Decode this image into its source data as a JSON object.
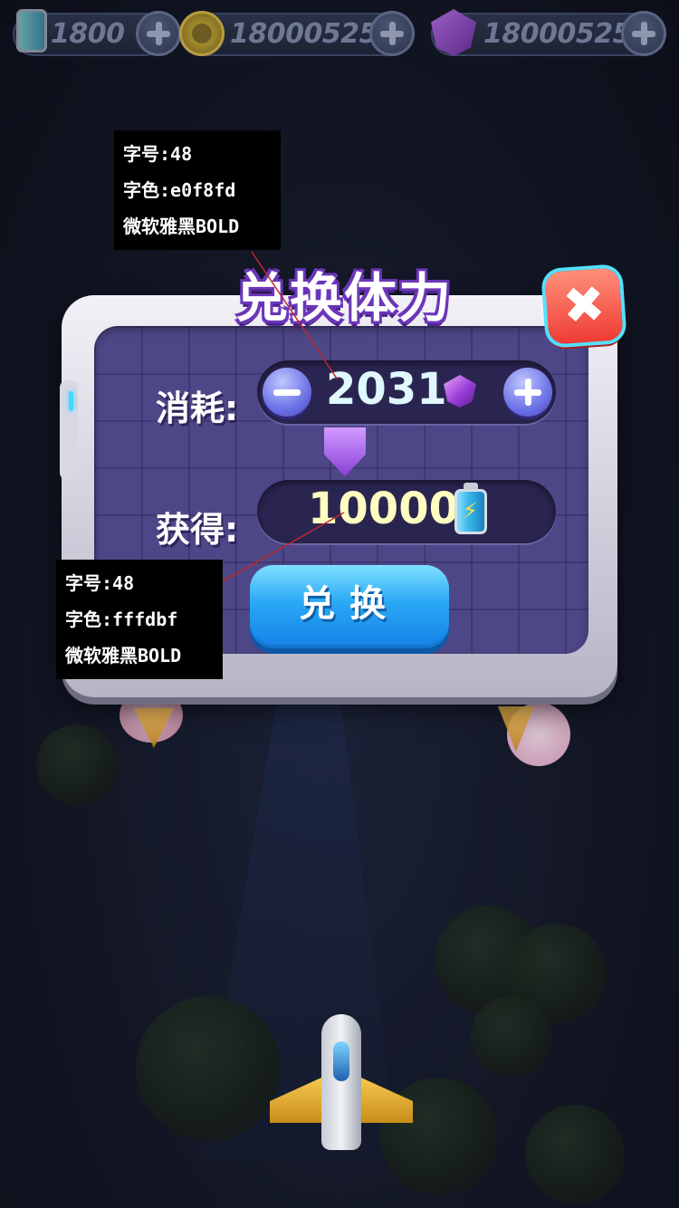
{
  "resources": {
    "energy": {
      "icon": "battery-icon",
      "value": "1800"
    },
    "coins": {
      "icon": "coin-icon",
      "value": "18000525"
    },
    "gems": {
      "icon": "gem-icon",
      "value": "18000525"
    }
  },
  "dialog": {
    "title": "兑换体力",
    "close_icon": "close-icon",
    "cost": {
      "label": "消耗:",
      "value": "2031",
      "icon": "gem-icon"
    },
    "gain": {
      "label": "获得:",
      "value": "10000",
      "icon": "battery-icon"
    },
    "exchange_button": "兑换"
  },
  "annotations": {
    "title_spec": {
      "size": "字号:48",
      "color": "字色:e0f8fd",
      "font": "微软雅黑BOLD"
    },
    "number_spec": {
      "size": "字号:48",
      "color": "字色:fffdbf",
      "font": "微软雅黑BOLD"
    }
  },
  "colors": {
    "title_text": "#e0f8fd",
    "number_text": "#fffdbf",
    "dialog_panel": "#4e4787",
    "exchange_button": "#1e93ee",
    "close_button": "#f04a3e"
  }
}
